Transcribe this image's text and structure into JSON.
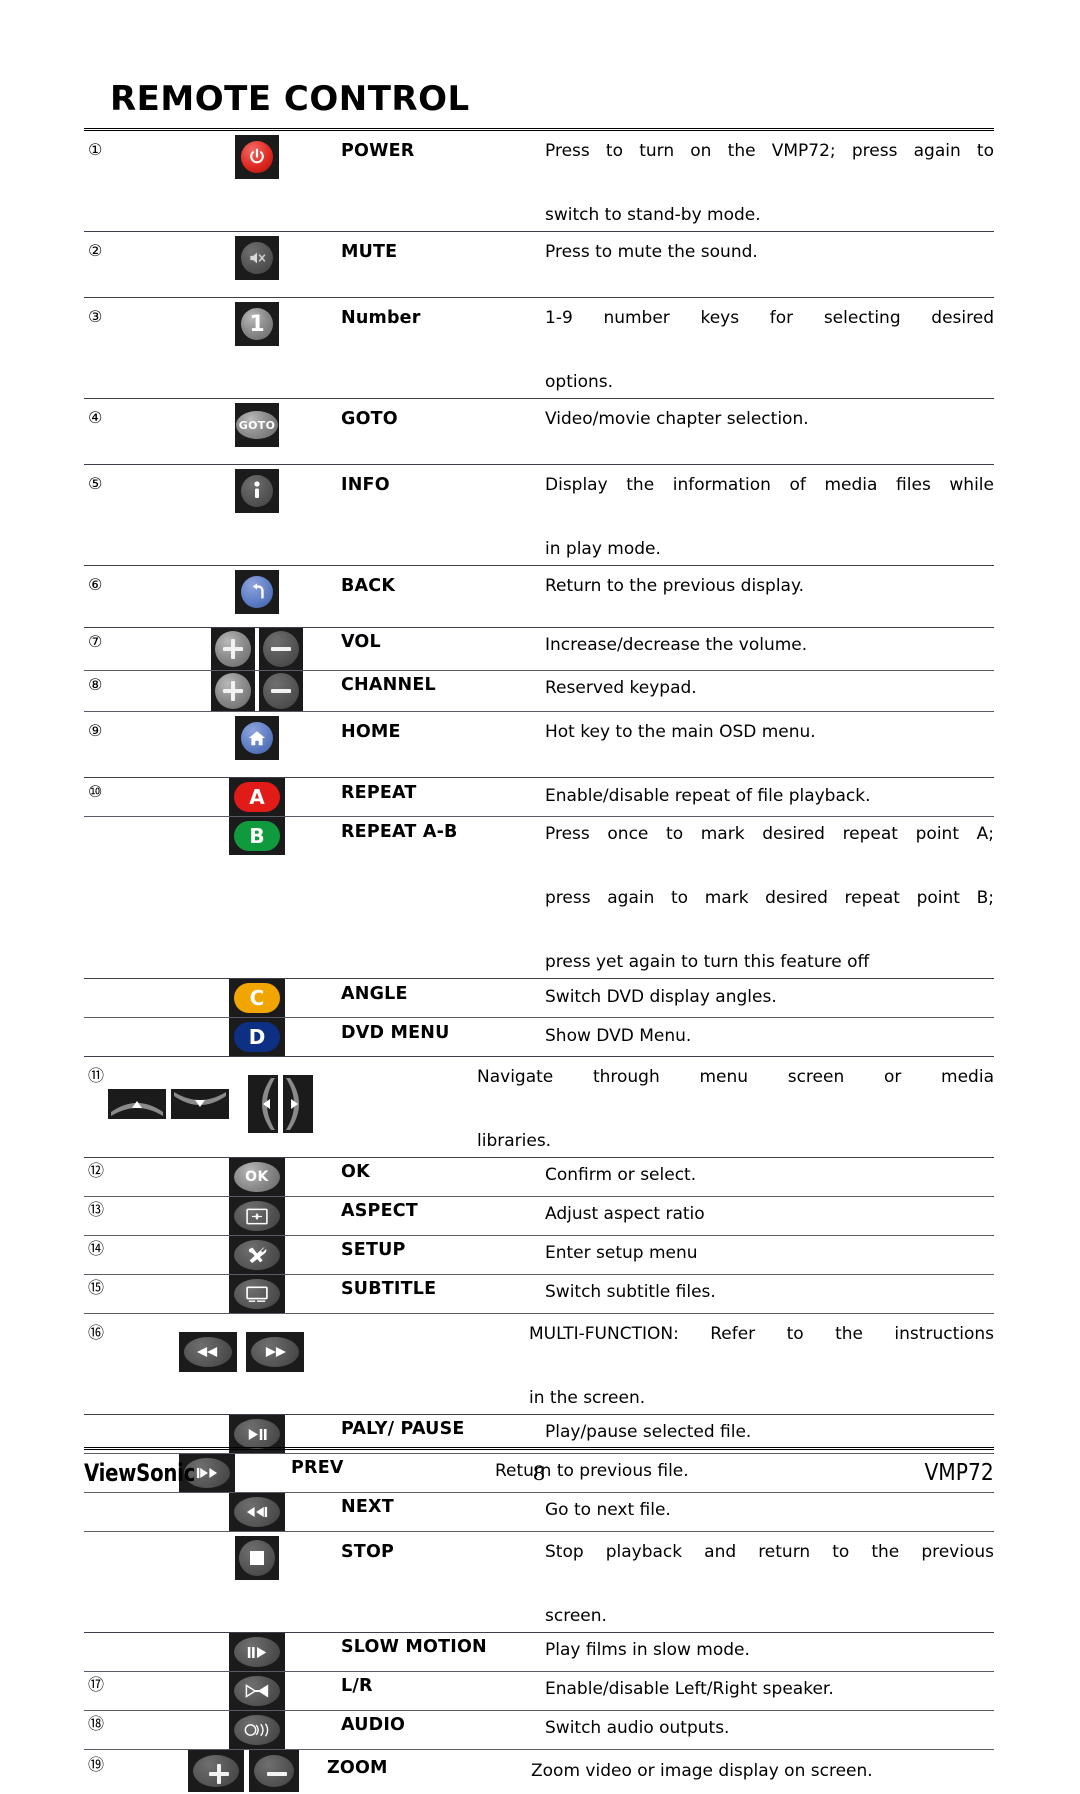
{
  "page": {
    "title": "REMOTE CONTROL",
    "footer": {
      "brand": "ViewSonic",
      "page_number": "8",
      "model": "VMP72"
    }
  },
  "table": {
    "rows": [
      {
        "num": "①",
        "icon": "power-button-icon",
        "label": "POWER",
        "desc_lines": [
          "Press to turn on the VMP72; press again to",
          "switch to stand-by mode."
        ]
      },
      {
        "num": "②",
        "icon": "mute-button-icon",
        "label": "MUTE",
        "desc_lines": [
          "Press to mute the sound."
        ]
      },
      {
        "num": "③",
        "icon": "number-one-button-icon",
        "label": "Number",
        "desc_lines": [
          "1-9 number keys for selecting desired",
          "options."
        ]
      },
      {
        "num": "④",
        "icon": "goto-button-icon",
        "label": "GOTO",
        "desc_lines": [
          "Video/movie chapter selection."
        ]
      },
      {
        "num": "⑤",
        "icon": "info-button-icon",
        "label": "INFO",
        "desc_lines": [
          "Display the information of media files while",
          "in play mode."
        ]
      },
      {
        "num": "⑥",
        "icon": "back-button-icon",
        "label": "BACK",
        "desc_lines": [
          "Return to the previous display."
        ]
      },
      {
        "num": "⑦",
        "icon": "volume-plus-minus-icon",
        "label": "VOL",
        "desc_lines": [
          "Increase/decrease the volume."
        ]
      },
      {
        "num": "⑧",
        "icon": "channel-plus-minus-icon",
        "label": "CHANNEL",
        "desc_lines": [
          "Reserved keypad."
        ]
      },
      {
        "num": "⑨",
        "icon": "home-button-icon",
        "label": "HOME",
        "desc_lines": [
          "Hot key to the main OSD menu."
        ]
      },
      {
        "num": "⑩",
        "icon": "red-a-button-icon",
        "label": "REPEAT",
        "desc_lines": [
          "Enable/disable repeat of file playback."
        ]
      },
      {
        "num": "",
        "icon": "green-b-button-icon",
        "label": "REPEAT A-B",
        "desc_lines": [
          "Press once to mark desired repeat point A;",
          "press again to mark desired repeat point B;",
          "press yet again to turn this feature off"
        ]
      },
      {
        "num": "",
        "icon": "amber-c-button-icon",
        "label": "ANGLE",
        "desc_lines": [
          "Switch DVD display angles."
        ]
      },
      {
        "num": "",
        "icon": "blue-d-button-icon",
        "label": "DVD MENU",
        "desc_lines": [
          "Show DVD Menu."
        ]
      },
      {
        "num": "⑪",
        "icon": "navigation-arrows-icon",
        "label": "",
        "desc_lines": [
          "Navigate through menu screen or media",
          "libraries."
        ]
      },
      {
        "num": "⑫",
        "icon": "ok-button-icon",
        "label": "OK",
        "desc_lines": [
          "Confirm or select."
        ]
      },
      {
        "num": "⑬",
        "icon": "aspect-button-icon",
        "label": "ASPECT",
        "desc_lines": [
          "Adjust aspect ratio"
        ]
      },
      {
        "num": "⑭",
        "icon": "setup-tools-button-icon",
        "label": "SETUP",
        "desc_lines": [
          "Enter setup menu"
        ]
      },
      {
        "num": "⑮",
        "icon": "subtitle-button-icon",
        "label": "SUBTITLE",
        "desc_lines": [
          "Switch subtitle files."
        ]
      },
      {
        "num": "⑯",
        "icon": "rewind-fastforward-icon",
        "label": "",
        "desc_lines": [
          "MULTI-FUNCTION: Refer to the instructions",
          "in the screen."
        ]
      },
      {
        "num": "",
        "icon": "play-pause-button-icon",
        "label": "PALY/ PAUSE",
        "desc_lines": [
          "Play/pause selected file."
        ]
      },
      {
        "num": "",
        "icon": "previous-track-button-icon",
        "label": "PREV",
        "desc_lines": [
          "Return to previous file."
        ]
      },
      {
        "num": "",
        "icon": "next-track-button-icon",
        "label": "NEXT",
        "desc_lines": [
          "Go to next file."
        ]
      },
      {
        "num": "",
        "icon": "stop-button-icon",
        "label": "STOP",
        "desc_lines": [
          "Stop playback and return to the previous",
          "screen."
        ]
      },
      {
        "num": "",
        "icon": "slow-motion-button-icon",
        "label": "SLOW MOTION",
        "desc_lines": [
          "Play films in slow mode."
        ]
      },
      {
        "num": "⑰",
        "icon": "left-right-speaker-button-icon",
        "label": "L/R",
        "desc_lines": [
          "Enable/disable Left/Right speaker."
        ]
      },
      {
        "num": "⑱",
        "icon": "audio-button-icon",
        "label": "AUDIO",
        "desc_lines": [
          "Switch audio outputs."
        ]
      },
      {
        "num": "⑲",
        "icon": "zoom-plus-minus-icon",
        "label": "ZOOM",
        "desc_lines": [
          "Zoom video or image display on screen."
        ]
      }
    ]
  },
  "colors": {
    "power_red": "#e02a23",
    "back_blue": "#5f7ec4",
    "home_blue": "#5f7ec4",
    "button_a_red": "#e01b18",
    "button_b_green": "#109a3e",
    "button_c_amber": "#f0a500",
    "button_d_blue": "#0d2f84",
    "chip_black": "#1b1b1b",
    "knob_grey": "#8d8d8d"
  },
  "icon_text": {
    "goto": "GOTO",
    "one": "1",
    "ok": "OK",
    "a": "A",
    "b": "B",
    "c": "C",
    "d": "D"
  }
}
